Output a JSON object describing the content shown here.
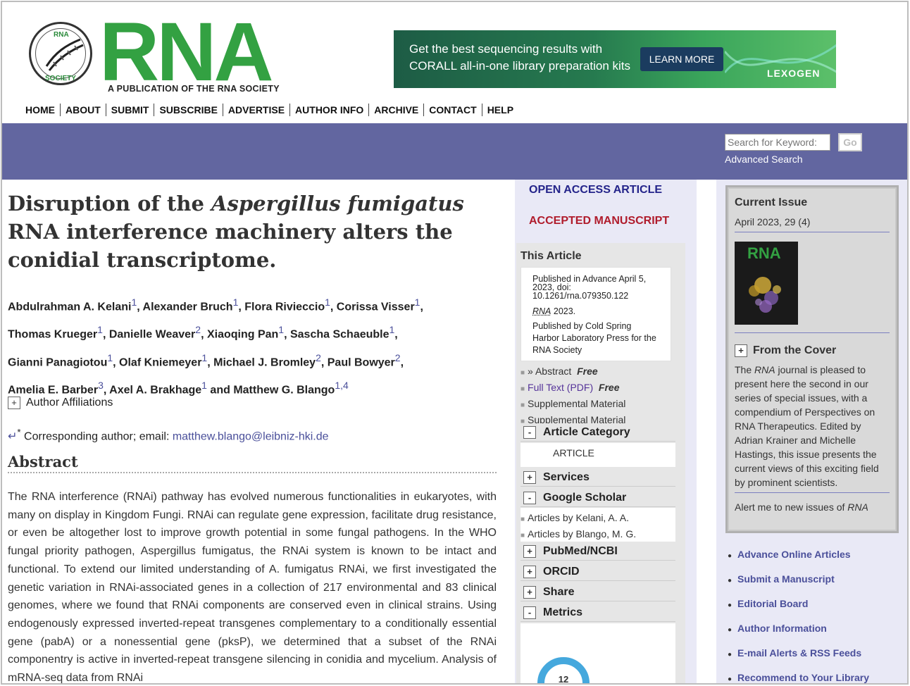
{
  "header": {
    "logo_text": "RNA",
    "logo_subtitle": "A PUBLICATION OF THE RNA SOCIETY",
    "seal_text_top": "RNA",
    "seal_text_bottom": "SOCIETY"
  },
  "ad": {
    "line1": "Get the best sequencing results with",
    "line2": "CORALL all-in-one library preparation kits",
    "button": "LEARN MORE",
    "brand": "LEXOGEN"
  },
  "nav": [
    "HOME",
    "ABOUT",
    "SUBMIT",
    "SUBSCRIBE",
    "ADVERTISE",
    "AUTHOR INFO",
    "ARCHIVE",
    "CONTACT",
    "HELP"
  ],
  "search": {
    "placeholder": "Search for Keyword:",
    "go": "Go",
    "advanced": "Advanced Search"
  },
  "article": {
    "title_part1": "Disruption of the ",
    "title_italic": "Aspergillus fumigatus",
    "title_part2": " RNA interference machinery alters the conidial transcriptome.",
    "authors": [
      {
        "name": "Abdulrahman A. Kelani",
        "sup": "1"
      },
      {
        "name": "Alexander Bruch",
        "sup": "1"
      },
      {
        "name": "Flora Rivieccio",
        "sup": "1"
      },
      {
        "name": "Corissa Visser",
        "sup": "1"
      },
      {
        "name": "Thomas Krueger",
        "sup": "1"
      },
      {
        "name": "Danielle Weaver",
        "sup": "2"
      },
      {
        "name": "Xiaoqing Pan",
        "sup": "1"
      },
      {
        "name": "Sascha Schaeuble",
        "sup": "1"
      },
      {
        "name": "Gianni Panagiotou",
        "sup": "1"
      },
      {
        "name": "Olaf Kniemeyer",
        "sup": "1"
      },
      {
        "name": "Michael J. Bromley",
        "sup": "2"
      },
      {
        "name": "Paul Bowyer",
        "sup": "2"
      },
      {
        "name": "Amelia E. Barber",
        "sup": "3"
      },
      {
        "name": "Axel A. Brakhage",
        "sup": "1"
      },
      {
        "name": "Matthew G. Blango",
        "sup": "1,4"
      }
    ],
    "author_affiliations": "Author Affiliations",
    "corresponding_prefix": "Corresponding author; email: ",
    "corresponding_email": "matthew.blango@leibniz-hki.de",
    "abstract_heading": "Abstract",
    "abstract_text": "The RNA interference (RNAi) pathway has evolved numerous functionalities in eukaryotes, with many on display in Kingdom Fungi. RNAi can regulate gene expression, facilitate drug resistance, or even be altogether lost to improve growth potential in some fungal pathogens. In the WHO fungal priority pathogen, Aspergillus fumigatus, the RNAi system is known to be intact and functional. To extend our limited understanding of A. fumigatus RNAi, we first investigated the genetic variation in RNAi-associated genes in a collection of 217 environmental and 83 clinical genomes, where we found that RNAi components are conserved even in clinical strains. Using endogenously expressed inverted-repeat transgenes complementary to a conditionally essential gene (pabA) or a nonessential gene (pksP), we determined that a subset of the RNAi componentry is active in inverted-repeat transgene silencing in conidia and mycelium. Analysis of mRNA-seq data from RNAi"
  },
  "sidebar": {
    "open_access": "OPEN ACCESS ARTICLE",
    "accepted": "ACCEPTED MANUSCRIPT",
    "this_article": "This Article",
    "pub_line1": "Published in Advance April 5, 2023, doi: 10.1261/rna.079350.122",
    "pub_journal": "RNA",
    "pub_year": " 2023.",
    "pub_publisher": "Published by Cold Spring Harbor Laboratory Press for the RNA Society",
    "links": [
      {
        "label": "» Abstract",
        "tag": "Free"
      },
      {
        "label": "Full Text (PDF)",
        "tag": "Free"
      },
      {
        "label": "Supplemental Material",
        "tag": ""
      },
      {
        "label": "Supplemental Material",
        "tag": ""
      }
    ],
    "article_category": "Article Category",
    "article_category_value": "ARTICLE",
    "services": "Services",
    "google_scholar": "Google Scholar",
    "scholar_links": [
      "Articles by Kelani, A. A.",
      "Articles by Blango, M. G."
    ],
    "pubmed": "PubMed/NCBI",
    "orcid": "ORCID",
    "share": "Share",
    "metrics": "Metrics",
    "metric_badge": "12"
  },
  "right": {
    "current_issue": "Current Issue",
    "issue_date": "April 2023, 29 (4)",
    "cover_title": "RNA",
    "from_cover": "From the Cover",
    "cover_text_pre": "The ",
    "cover_text_journal": "RNA",
    "cover_text_post": " journal is pleased to present here the second in our series of special issues, with a compendium of Perspectives on RNA Therapeutics. Edited by Adrian Krainer and Michelle Hastings, this issue presents the current views of this exciting field by prominent scientists.",
    "alert_pre": "Alert me to new issues of ",
    "alert_journal": "RNA",
    "links": [
      "Advance Online Articles",
      "Submit a Manuscript",
      "Editorial Board",
      "Author Information",
      "E-mail Alerts & RSS Feeds",
      "Recommend to Your Library"
    ]
  },
  "colors": {
    "brand_green": "#33a142",
    "bar_blue": "#6266a0",
    "link_purple": "#4a4f9a",
    "accepted_red": "#b01c2c",
    "open_access_navy": "#24248a"
  }
}
